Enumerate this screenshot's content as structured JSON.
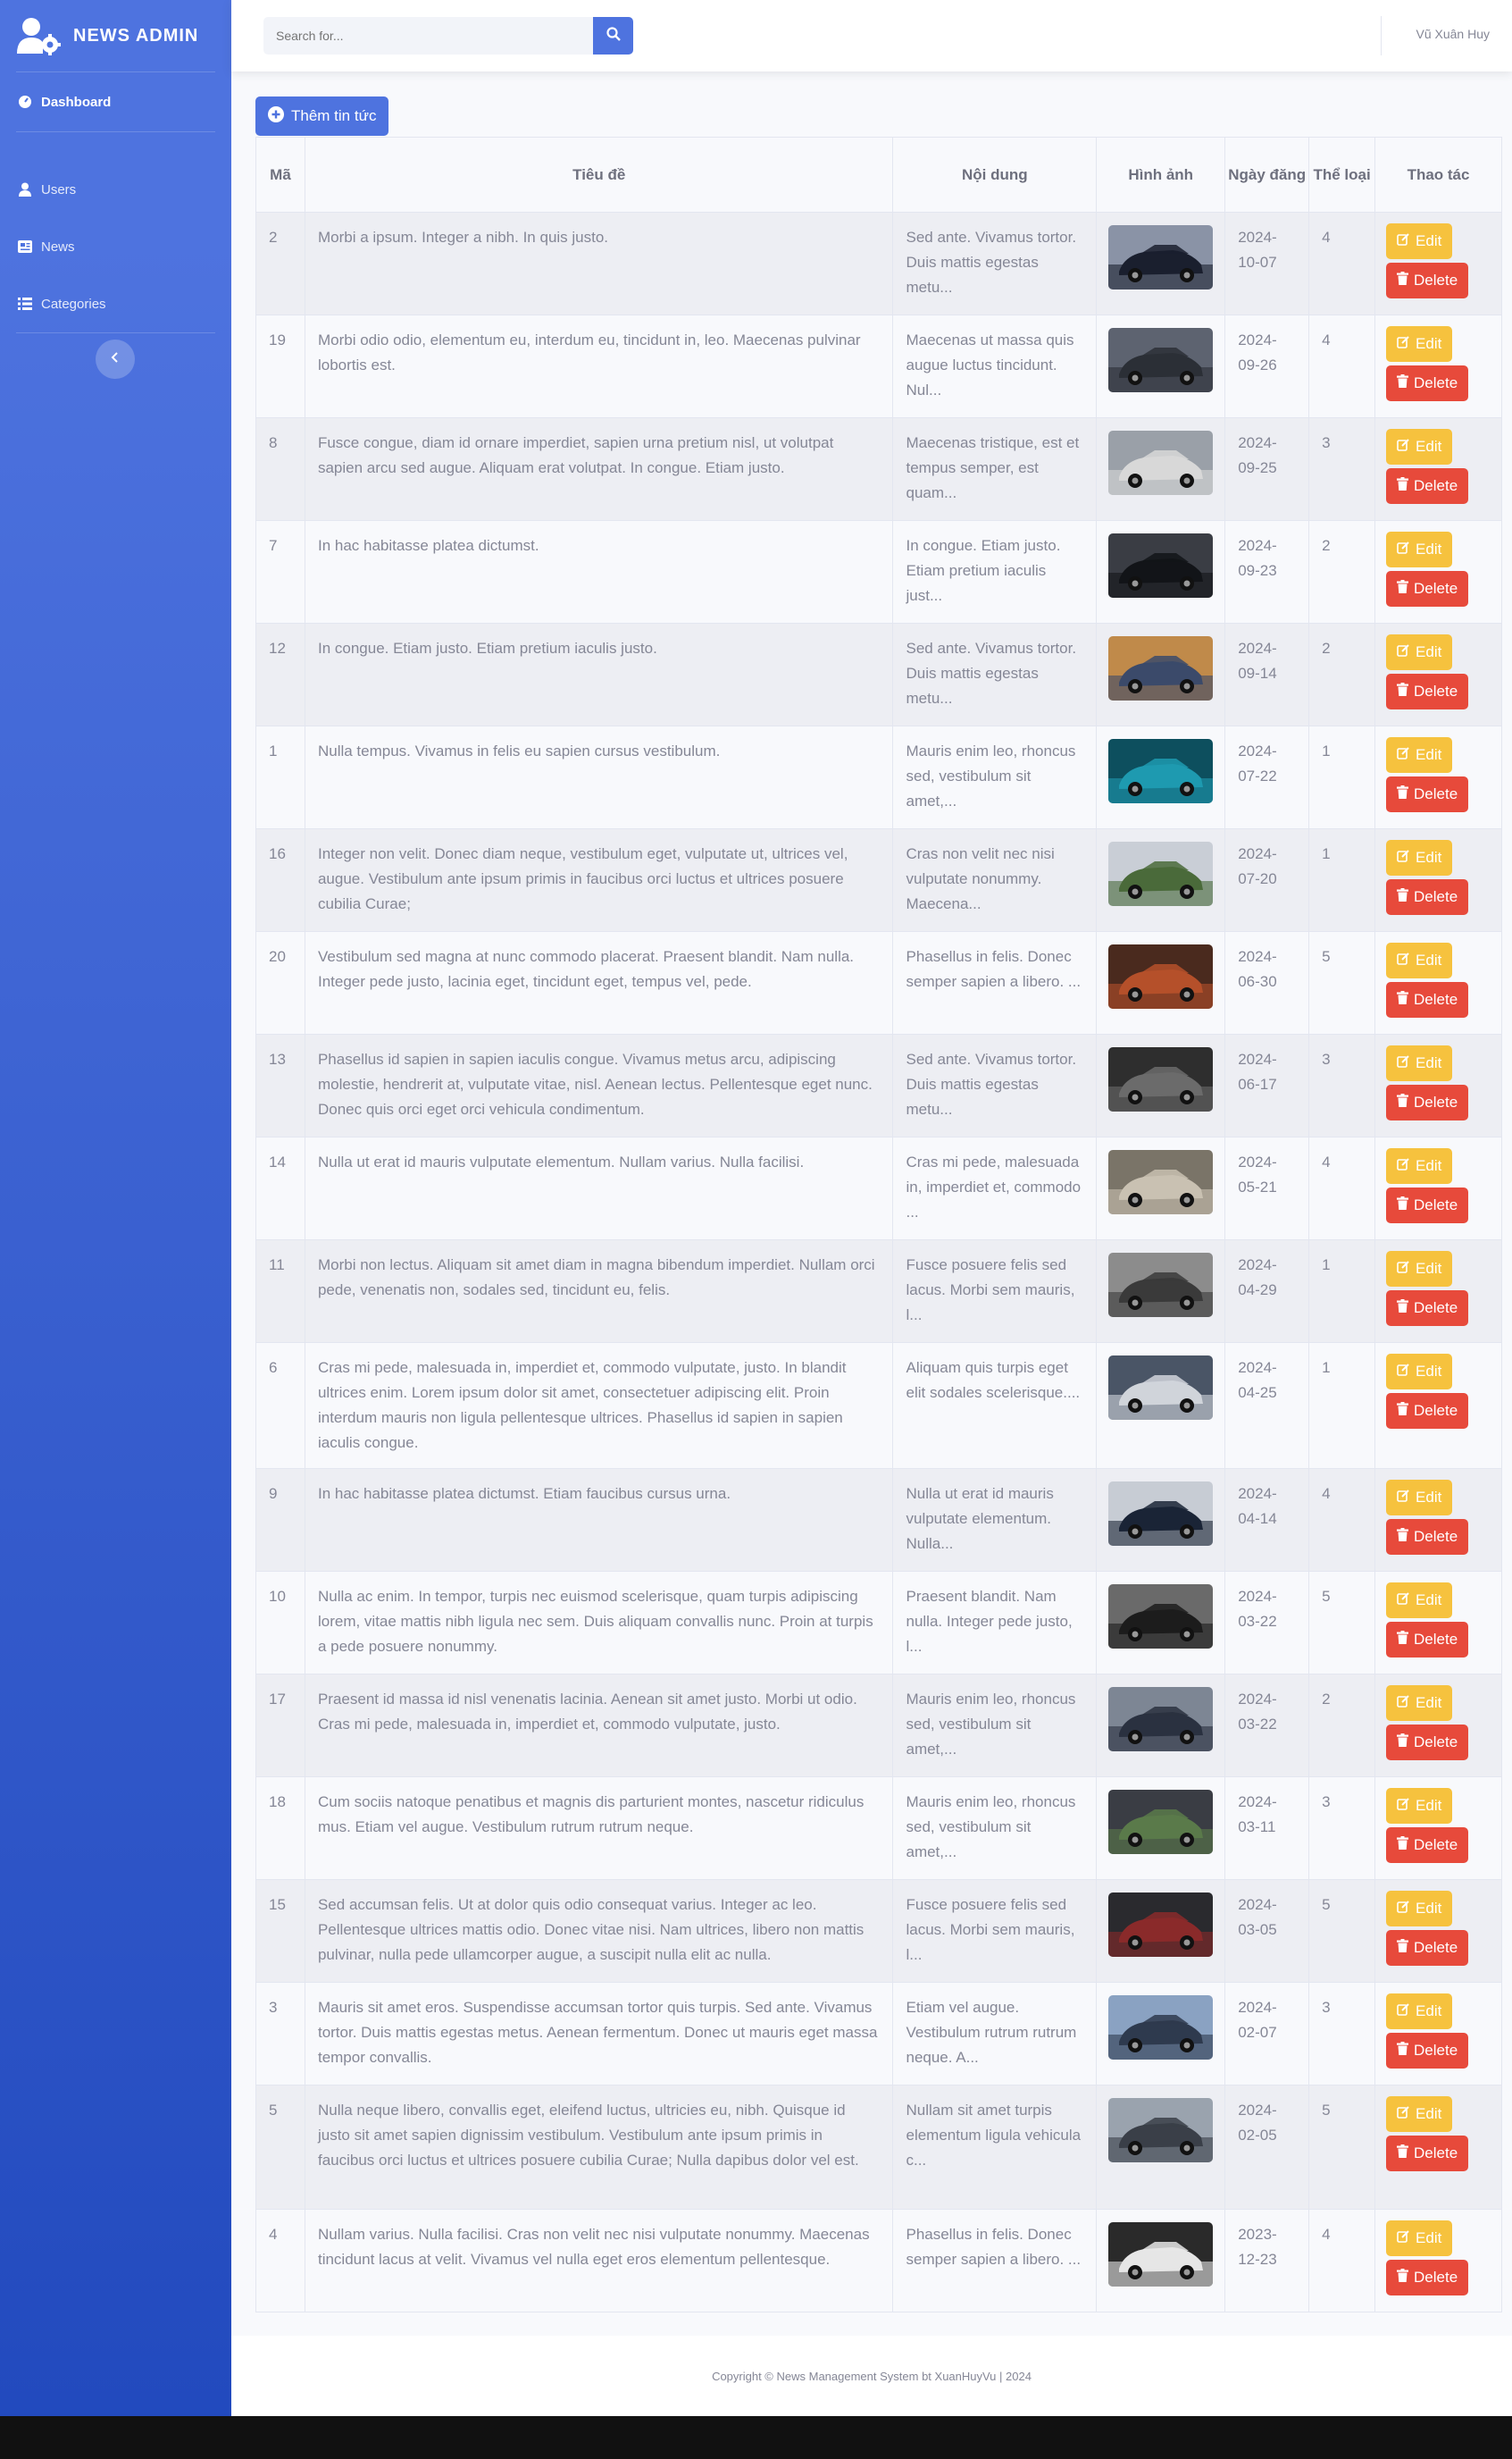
{
  "brand": {
    "name": "NEWS ADMIN",
    "icon": "users-cog-icon"
  },
  "sidebar": {
    "items": [
      {
        "label": "Dashboard",
        "icon": "dashboard-icon",
        "active": true
      },
      {
        "label": "Users",
        "icon": "user-icon",
        "active": false
      },
      {
        "label": "News",
        "icon": "newspaper-icon",
        "active": false
      },
      {
        "label": "Categories",
        "icon": "list-icon",
        "active": false
      }
    ]
  },
  "topbar": {
    "search_placeholder": "Search for...",
    "user_name": "Vũ Xuân Huy"
  },
  "main": {
    "add_label": "Thêm tin tức"
  },
  "table": {
    "headers": [
      "Mã",
      "Tiêu đề",
      "Nội dung",
      "Hình ảnh",
      "Ngày đăng",
      "Thể loại",
      "Thao tác"
    ],
    "edit_label": "Edit",
    "delete_label": "Delete",
    "rows": [
      {
        "id": "2",
        "title": "Morbi a ipsum. Integer a nibh. In quis justo.",
        "content": "Sed ante. Vivamus tortor. Duis mattis egestas metu...",
        "date": "2024-10-07",
        "category": "4",
        "img": [
          "#1a1f2e",
          "#8a93a6"
        ]
      },
      {
        "id": "19",
        "title": "Morbi odio odio, elementum eu, interdum eu, tincidunt in, leo. Maecenas pulvinar lobortis est.",
        "content": "Maecenas ut massa quis augue luctus tincidunt. Nul...",
        "date": "2024-09-26",
        "category": "4",
        "img": [
          "#2b2f36",
          "#5d6370"
        ]
      },
      {
        "id": "8",
        "title": "Fusce congue, diam id ornare imperdiet, sapien urna pretium nisl, ut volutpat sapien arcu sed augue. Aliquam erat volutpat. In congue. Etiam justo.",
        "content": "Maecenas tristique, est et tempus semper, est quam...",
        "date": "2024-09-25",
        "category": "3",
        "img": [
          "#d8d8d8",
          "#9aa0a8"
        ]
      },
      {
        "id": "7",
        "title": "In hac habitasse platea dictumst.",
        "content": "In congue. Etiam justo. Etiam pretium iaculis just...",
        "date": "2024-09-23",
        "category": "2",
        "img": [
          "#121418",
          "#3a3d44"
        ]
      },
      {
        "id": "12",
        "title": "In congue. Etiam justo. Etiam pretium iaculis justo.",
        "content": "Sed ante. Vivamus tortor. Duis mattis egestas metu...",
        "date": "2024-09-14",
        "category": "2",
        "img": [
          "#3b4a6a",
          "#c08a4a"
        ]
      },
      {
        "id": "1",
        "title": "Nulla tempus. Vivamus in felis eu sapien cursus vestibulum.",
        "content": "Mauris enim leo, rhoncus sed, vestibulum sit amet,...",
        "date": "2024-07-22",
        "category": "1",
        "img": [
          "#1e9ab0",
          "#0d4f5e"
        ]
      },
      {
        "id": "16",
        "title": "Integer non velit. Donec diam neque, vestibulum eget, vulputate ut, ultrices vel, augue. Vestibulum ante ipsum primis in faucibus orci luctus et ultrices posuere cubilia Curae;",
        "content": "Cras non velit nec nisi vulputate nonummy. Maecena...",
        "date": "2024-07-20",
        "category": "1",
        "img": [
          "#4a6a3a",
          "#c9ced6"
        ]
      },
      {
        "id": "20",
        "title": "Vestibulum sed magna at nunc commodo placerat. Praesent blandit. Nam nulla. Integer pede justo, lacinia eget, tincidunt eget, tempus vel, pede.",
        "content": "Phasellus in felis. Donec semper sapien a libero. ...",
        "date": "2024-06-30",
        "category": "5",
        "img": [
          "#b5502a",
          "#4a2a1e"
        ]
      },
      {
        "id": "13",
        "title": "Phasellus id sapien in sapien iaculis congue. Vivamus metus arcu, adipiscing molestie, hendrerit at, vulputate vitae, nisl. Aenean lectus. Pellentesque eget nunc. Donec quis orci eget orci vehicula condimentum.",
        "content": "Sed ante. Vivamus tortor. Duis mattis egestas metu...",
        "date": "2024-06-17",
        "category": "3",
        "img": [
          "#6b6b6b",
          "#2e2e2e"
        ]
      },
      {
        "id": "14",
        "title": "Nulla ut erat id mauris vulputate elementum. Nullam varius. Nulla facilisi.",
        "content": "Cras mi pede, malesuada in, imperdiet et, commodo ...",
        "date": "2024-05-21",
        "category": "4",
        "img": [
          "#c9c1b2",
          "#7a7468"
        ]
      },
      {
        "id": "11",
        "title": "Morbi non lectus. Aliquam sit amet diam in magna bibendum imperdiet. Nullam orci pede, venenatis non, sodales sed, tincidunt eu, felis.",
        "content": "Fusce posuere felis sed lacus. Morbi sem mauris, l...",
        "date": "2024-04-29",
        "category": "1",
        "img": [
          "#3a3a3a",
          "#8c8c8c"
        ]
      },
      {
        "id": "6",
        "title": "Cras mi pede, malesuada in, imperdiet et, commodo vulputate, justo. In blandit ultrices enim. Lorem ipsum dolor sit amet, consectetuer adipiscing elit. Proin interdum mauris non ligula pellentesque ultrices. Phasellus id sapien in sapien iaculis congue.",
        "content": "Aliquam quis turpis eget elit sodales scelerisque....",
        "date": "2024-04-25",
        "category": "1",
        "img": [
          "#d0d4da",
          "#4a5566"
        ]
      },
      {
        "id": "9",
        "title": "In hac habitasse platea dictumst. Etiam faucibus cursus urna.",
        "content": "Nulla ut erat id mauris vulputate elementum. Nulla...",
        "date": "2024-04-14",
        "category": "4",
        "img": [
          "#1a2436",
          "#c7ccd4"
        ]
      },
      {
        "id": "10",
        "title": "Nulla ac enim. In tempor, turpis nec euismod scelerisque, quam turpis adipiscing lorem, vitae mattis nibh ligula nec sem. Duis aliquam convallis nunc. Proin at turpis a pede posuere nonummy.",
        "content": "Praesent blandit. Nam nulla. Integer pede justo, l...",
        "date": "2024-03-22",
        "category": "5",
        "img": [
          "#1c1c1c",
          "#6a6a6a"
        ]
      },
      {
        "id": "17",
        "title": "Praesent id massa id nisl venenatis lacinia. Aenean sit amet justo. Morbi ut odio. Cras mi pede, malesuada in, imperdiet et, commodo vulputate, justo.",
        "content": "Mauris enim leo, rhoncus sed, vestibulum sit amet,...",
        "date": "2024-03-22",
        "category": "2",
        "img": [
          "#2a3140",
          "#7d8694"
        ]
      },
      {
        "id": "18",
        "title": "Cum sociis natoque penatibus et magnis dis parturient montes, nascetur ridiculus mus. Etiam vel augue. Vestibulum rutrum rutrum neque.",
        "content": "Mauris enim leo, rhoncus sed, vestibulum sit amet,...",
        "date": "2024-03-11",
        "category": "3",
        "img": [
          "#5a7a4a",
          "#3a3d44"
        ]
      },
      {
        "id": "15",
        "title": "Sed accumsan felis. Ut at dolor quis odio consequat varius. Integer ac leo. Pellentesque ultrices mattis odio. Donec vitae nisi. Nam ultrices, libero non mattis pulvinar, nulla pede ullamcorper augue, a suscipit nulla elit ac nulla.",
        "content": "Fusce posuere felis sed lacus. Morbi sem mauris, l...",
        "date": "2024-03-05",
        "category": "5",
        "img": [
          "#8a2a2a",
          "#2a2a2e"
        ]
      },
      {
        "id": "3",
        "title": "Mauris sit amet eros. Suspendisse accumsan tortor quis turpis. Sed ante. Vivamus tortor. Duis mattis egestas metus. Aenean fermentum. Donec ut mauris eget massa tempor convallis.",
        "content": "Etiam vel augue. Vestibulum rutrum rutrum neque. A...",
        "date": "2024-02-07",
        "category": "3",
        "img": [
          "#2e3a4e",
          "#8aa2c2"
        ]
      },
      {
        "id": "5",
        "title": "Nulla neque libero, convallis eget, eleifend luctus, ultricies eu, nibh. Quisque id justo sit amet sapien dignissim vestibulum. Vestibulum ante ipsum primis in faucibus orci luctus et ultrices posuere cubilia Curae; Nulla dapibus dolor vel est.",
        "content": "Nullam sit amet turpis elementum ligula vehicula c...",
        "date": "2024-02-05",
        "category": "5",
        "img": [
          "#3a3f48",
          "#9aa3ae"
        ]
      },
      {
        "id": "4",
        "title": "Nullam varius. Nulla facilisi. Cras non velit nec nisi vulputate nonummy. Maecenas tincidunt lacus at velit. Vivamus vel nulla eget eros elementum pellentesque.",
        "content": "Phasellus in felis. Donec semper sapien a libero. ...",
        "date": "2023-12-23",
        "category": "4",
        "img": [
          "#e6e6e6",
          "#2a2a2a"
        ]
      }
    ]
  },
  "footer": {
    "text": "Copyright © News Management System bt XuanHuyVu | 2024"
  },
  "colors": {
    "primary": "#4e73df",
    "warning": "#f6c23e",
    "danger": "#e74a3b"
  }
}
